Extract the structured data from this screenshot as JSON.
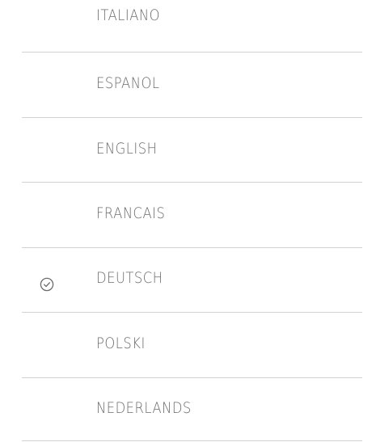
{
  "language_list": {
    "selected": "DEUTSCH",
    "items": [
      {
        "label": "ITALIANO",
        "selected": false
      },
      {
        "label": "ESPANOL",
        "selected": false
      },
      {
        "label": "ENGLISH",
        "selected": false
      },
      {
        "label": "FRANCAIS",
        "selected": false
      },
      {
        "label": "DEUTSCH",
        "selected": true
      },
      {
        "label": "POLSKI",
        "selected": false
      },
      {
        "label": "NEDERLANDS",
        "selected": false
      }
    ],
    "selected_icon": "check-circle-icon"
  },
  "colors": {
    "text": "#6c6c6c",
    "divider": "#d2d2d2",
    "background": "#ffffff"
  }
}
